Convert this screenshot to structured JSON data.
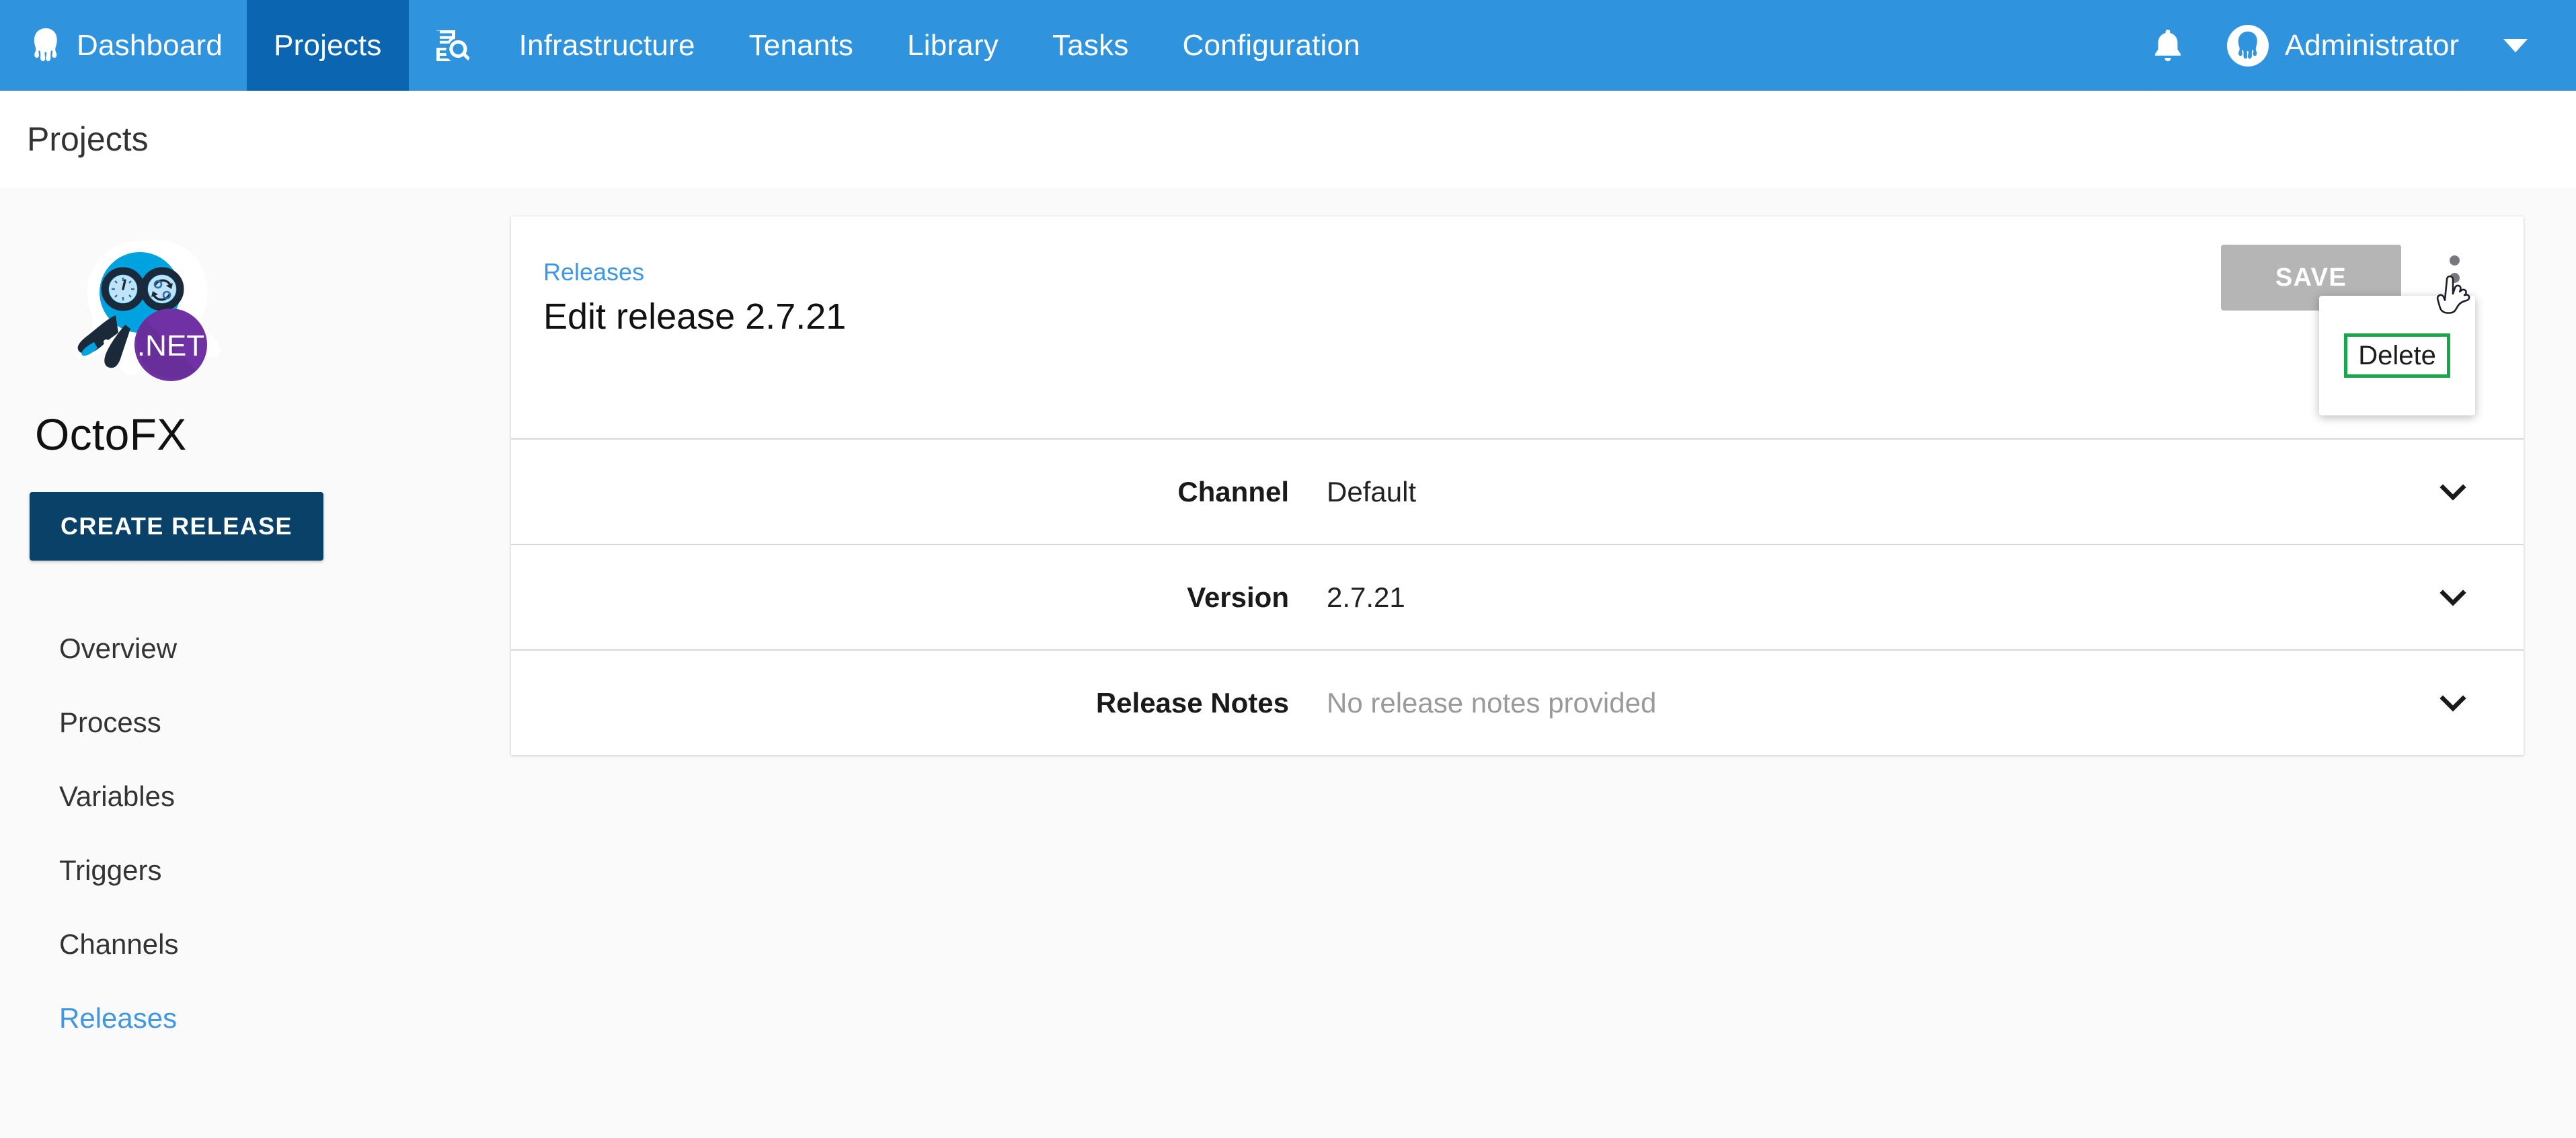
{
  "topnav": {
    "items": [
      {
        "label": "Dashboard",
        "icon": "octopus-logo-icon",
        "active": false
      },
      {
        "label": "Projects",
        "icon": "",
        "active": true
      },
      {
        "label": "",
        "icon": "search-documents-icon",
        "active": false
      },
      {
        "label": "Infrastructure",
        "icon": "",
        "active": false
      },
      {
        "label": "Tenants",
        "icon": "",
        "active": false
      },
      {
        "label": "Library",
        "icon": "",
        "active": false
      },
      {
        "label": "Tasks",
        "icon": "",
        "active": false
      },
      {
        "label": "Configuration",
        "icon": "",
        "active": false
      }
    ],
    "notifications_icon": "bell-icon",
    "user_name": "Administrator",
    "user_avatar_icon": "octopus-avatar-icon",
    "user_caret_icon": "chevron-down-icon",
    "bg_color": "#2f93de",
    "active_bg_color": "#0b65b0"
  },
  "page": {
    "title": "Projects"
  },
  "sidebar": {
    "project_logo_icon": "octofx-dotnet-logo-icon",
    "project_name": "OctoFX",
    "create_release_label": "CREATE RELEASE",
    "create_release_color": "#0a4169",
    "items": [
      {
        "label": "Overview",
        "active": false
      },
      {
        "label": "Process",
        "active": false
      },
      {
        "label": "Variables",
        "active": false
      },
      {
        "label": "Triggers",
        "active": false
      },
      {
        "label": "Channels",
        "active": false
      },
      {
        "label": "Releases",
        "active": true
      }
    ],
    "active_color": "#3f97e3"
  },
  "card": {
    "breadcrumb": "Releases",
    "title": "Edit release 2.7.21",
    "save_label": "SAVE",
    "save_disabled_color": "#b5b5b5",
    "overflow_icon": "kebab-menu-icon",
    "menu": {
      "items": [
        {
          "label": "Delete",
          "highlighted": true
        }
      ],
      "highlight_color": "#19a64a"
    },
    "rows": [
      {
        "label": "Channel",
        "value": "Default",
        "placeholder": false,
        "expand_icon": "chevron-down-icon"
      },
      {
        "label": "Version",
        "value": "2.7.21",
        "placeholder": false,
        "expand_icon": "chevron-down-icon"
      },
      {
        "label": "Release Notes",
        "value": "No release notes provided",
        "placeholder": true,
        "expand_icon": "chevron-down-icon"
      }
    ]
  },
  "cursor": {
    "type": "pointing-hand"
  }
}
